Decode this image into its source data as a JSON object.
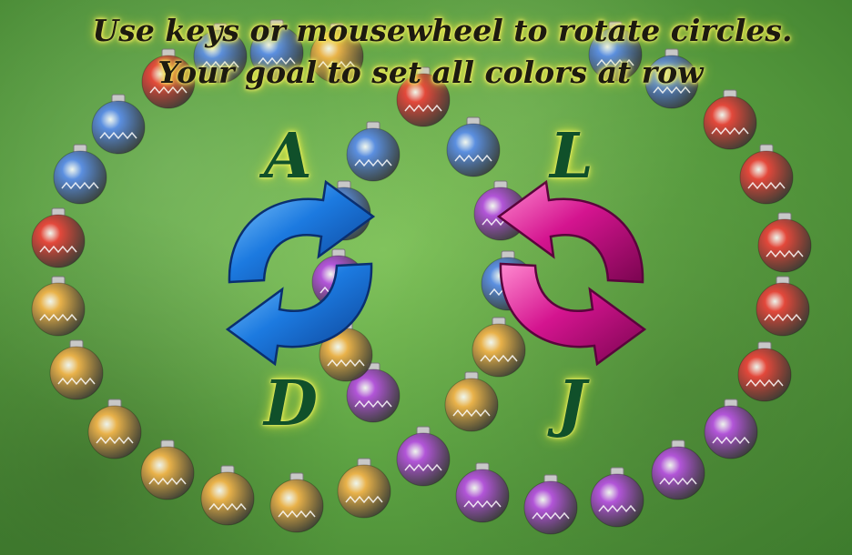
{
  "instructions": {
    "line1": "Use keys or mousewheel to rotate circles.",
    "line2": "Your goal to set all colors at row"
  },
  "left_circle": {
    "key_ccw": "A",
    "key_cw": "D",
    "arrow_color": "#1a73d6",
    "arrow_icon": "rotate-arrows-blue-icon"
  },
  "right_circle": {
    "key_ccw": "L",
    "key_cw": "J",
    "arrow_color": "#d4148f",
    "arrow_icon": "rotate-arrows-magenta-icon"
  },
  "ornament_colors": {
    "red": "#e3483b",
    "blue": "#5b8fe0",
    "gold": "#e9b24a",
    "purple": "#b255d8"
  },
  "ornament_icon": "christmas-ornament-icon"
}
